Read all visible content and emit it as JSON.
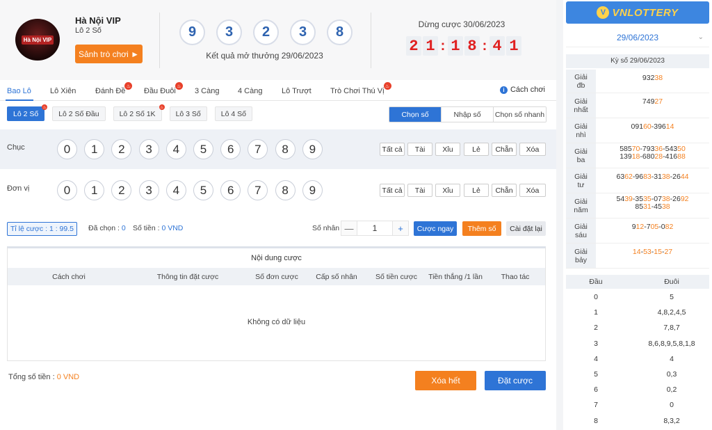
{
  "header": {
    "logo_text": "Hà Nội VIP",
    "game_title": "Hà Nội VIP",
    "game_sub": "Lô 2 Số",
    "lobby_button": "Sảnh trò chơi ►",
    "result_balls": [
      "9",
      "3",
      "2",
      "3",
      "8"
    ],
    "result_caption": "Kết quả mở thưởng 29/06/2023",
    "stop_caption": "Dừng cược 30/06/2023",
    "timer": [
      "2",
      "1",
      ":",
      "1",
      "8",
      ":",
      "4",
      "1"
    ]
  },
  "tabs": [
    "Bao Lô",
    "Lô Xiên",
    "Đánh Đề",
    "Đầu Đuôi",
    "3 Càng",
    "4 Càng",
    "Lô Trượt",
    "Trò Chơi Thú Vị"
  ],
  "rules_label": "Cách chơi",
  "subtabs": [
    "Lô 2 Số",
    "Lô 2 Số Đầu",
    "Lô 2 Số 1K",
    "Lô 3 Số",
    "Lô 4 Số"
  ],
  "modes": [
    "Chọn số",
    "Nhập số",
    "Chọn số nhanh"
  ],
  "pick_rows": [
    {
      "label": "Chục",
      "numbers": [
        "0",
        "1",
        "2",
        "3",
        "4",
        "5",
        "6",
        "7",
        "8",
        "9"
      ]
    },
    {
      "label": "Đơn vị",
      "numbers": [
        "0",
        "1",
        "2",
        "3",
        "4",
        "5",
        "6",
        "7",
        "8",
        "9"
      ]
    }
  ],
  "quick_buttons": [
    "Tất cả",
    "Tài",
    "Xỉu",
    "Lẻ",
    "Chẵn",
    "Xóa"
  ],
  "bet_bar": {
    "ratio_label": "Tỉ lệ cược :",
    "ratio_value": "1 : 99.5",
    "selected_label": "Đã chọn :",
    "selected_value": "0",
    "amount_label": "Số tiền :",
    "amount_value": "0 VND",
    "multiplier_label": "Số nhân :",
    "multiplier_minus": "—",
    "multiplier_value": "1",
    "multiplier_plus": "+",
    "bet_now": "Cược ngay",
    "add_number": "Thêm số",
    "reset": "Cài đặt lại"
  },
  "bet_table": {
    "title": "Nội dung cược",
    "columns": [
      "Cách chơi",
      "Thông tin đặt cược",
      "Số đơn cược",
      "Cấp số nhân",
      "Số tiền cược",
      "Tiền thắng /1 lần",
      "Thao tác"
    ],
    "empty": "Không có dữ liệu"
  },
  "footer": {
    "total_label": "Tổng số tiền :",
    "total_value": "0 VND",
    "clear_all": "Xóa hết",
    "place_bet": "Đặt cược"
  },
  "sidebar": {
    "brand": "VNLOTTERY",
    "date": "29/06/2023",
    "draw_title": "Kỳ số 29/06/2023",
    "prizes": [
      {
        "label": "Giải đb",
        "lines": [
          [
            [
              "932",
              false
            ],
            [
              "38",
              true
            ]
          ]
        ]
      },
      {
        "label": "Giải nhất",
        "lines": [
          [
            [
              "749",
              false
            ],
            [
              "27",
              true
            ]
          ]
        ]
      },
      {
        "label": "Giải nhì",
        "lines": [
          [
            [
              "091",
              false
            ],
            [
              "60",
              true
            ],
            [
              "-396",
              false
            ],
            [
              "14",
              true
            ]
          ]
        ]
      },
      {
        "label": "Giải ba",
        "lines": [
          [
            [
              "585",
              false
            ],
            [
              "70",
              true
            ],
            [
              "-793",
              false
            ],
            [
              "36",
              true
            ],
            [
              "-543",
              false
            ],
            [
              "50",
              true
            ]
          ],
          [
            [
              "139",
              false
            ],
            [
              "18",
              true
            ],
            [
              "-680",
              false
            ],
            [
              "28",
              true
            ],
            [
              "-416",
              false
            ],
            [
              "88",
              true
            ]
          ]
        ]
      },
      {
        "label": "Giải tư",
        "lines": [
          [
            [
              "63",
              false
            ],
            [
              "62",
              true
            ],
            [
              "-96",
              false
            ],
            [
              "83",
              true
            ],
            [
              "-31",
              false
            ],
            [
              "38",
              true
            ],
            [
              "-26",
              false
            ],
            [
              "44",
              true
            ]
          ]
        ]
      },
      {
        "label": "Giải năm",
        "lines": [
          [
            [
              "54",
              false
            ],
            [
              "39",
              true
            ],
            [
              "-35",
              false
            ],
            [
              "35",
              true
            ],
            [
              "-07",
              false
            ],
            [
              "38",
              true
            ],
            [
              "-26",
              false
            ],
            [
              "92",
              true
            ]
          ],
          [
            [
              "85",
              false
            ],
            [
              "31",
              true
            ],
            [
              "-45",
              false
            ],
            [
              "38",
              true
            ]
          ]
        ]
      },
      {
        "label": "Giải sáu",
        "lines": [
          [
            [
              "9",
              false
            ],
            [
              "12",
              true
            ],
            [
              "-7",
              false
            ],
            [
              "05",
              true
            ],
            [
              "-0",
              false
            ],
            [
              "82",
              true
            ]
          ]
        ]
      },
      {
        "label": "Giải bảy",
        "lines": [
          [
            [
              "14",
              true
            ],
            [
              "-",
              false
            ],
            [
              "53",
              true
            ],
            [
              "-",
              false
            ],
            [
              "15",
              true
            ],
            [
              "-",
              false
            ],
            [
              "27",
              true
            ]
          ]
        ]
      }
    ],
    "head_tail": {
      "col_a": "Đầu",
      "col_b": "Đuôi",
      "rows": [
        [
          "0",
          "5"
        ],
        [
          "1",
          "4,8,2,4,5"
        ],
        [
          "2",
          "7,8,7"
        ],
        [
          "3",
          "8,6,8,9,5,8,1,8"
        ],
        [
          "4",
          "4"
        ],
        [
          "5",
          "0,3"
        ],
        [
          "6",
          "0,2"
        ],
        [
          "7",
          "0"
        ],
        [
          "8",
          "8,3,2"
        ]
      ]
    }
  },
  "colors": {
    "accent": "#2e74d6",
    "orange": "#f4801f",
    "timer_red": "#e02020",
    "ball_blue": "#2e63b0"
  }
}
